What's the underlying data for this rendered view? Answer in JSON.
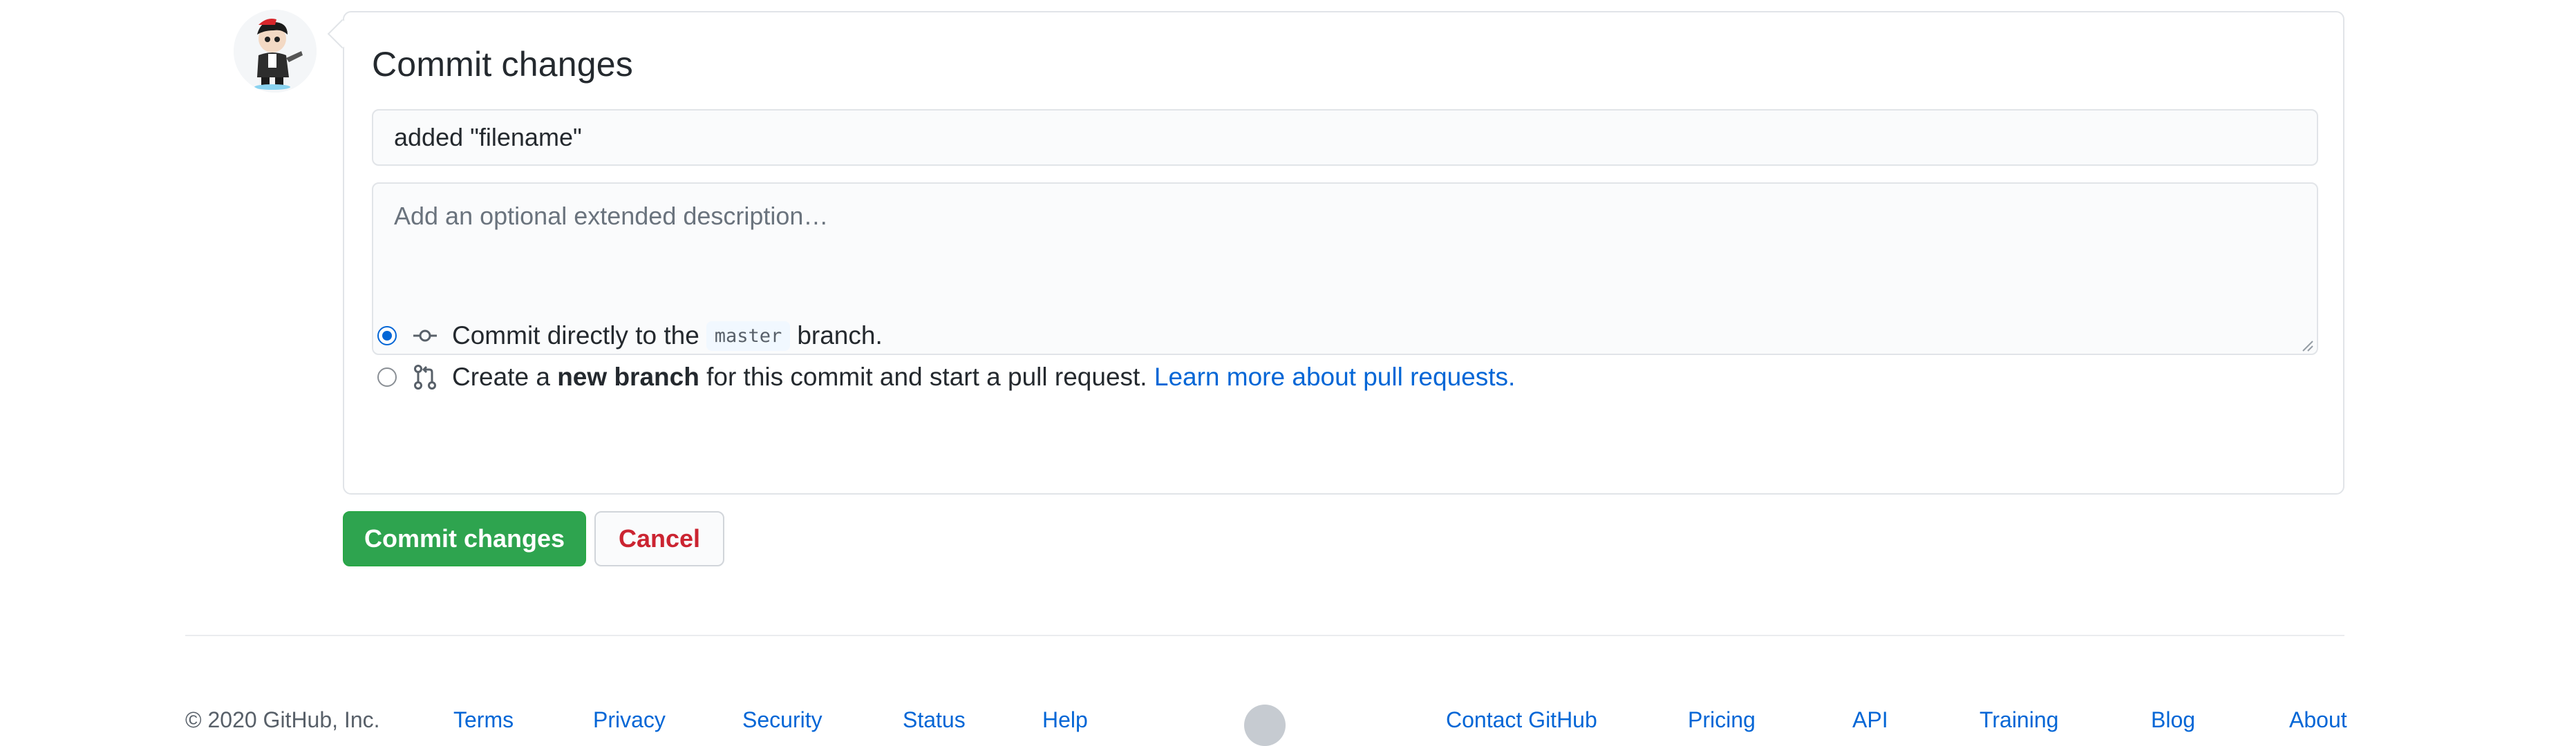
{
  "commit_box": {
    "title": "Commit changes",
    "summary_value": "added \"filename\"",
    "description_placeholder": "Add an optional extended description…"
  },
  "options": {
    "direct": {
      "prefix": "Commit directly to the",
      "branch": "master",
      "suffix": "branch.",
      "checked": true
    },
    "new_branch": {
      "prefix": "Create a",
      "bold": "new branch",
      "middle": "for this commit and start a pull request.",
      "link": "Learn more about pull requests.",
      "checked": false
    }
  },
  "buttons": {
    "commit": "Commit changes",
    "cancel": "Cancel"
  },
  "footer": {
    "copyright": "© 2020 GitHub, Inc.",
    "links_left": [
      "Terms",
      "Privacy",
      "Security",
      "Status",
      "Help"
    ],
    "links_right": [
      "Contact GitHub",
      "Pricing",
      "API",
      "Training",
      "Blog",
      "About"
    ]
  },
  "colors": {
    "primary_button": "#2ea44f",
    "cancel_text": "#cb2431",
    "link": "#0366d6",
    "radio_checked": "#0366d6"
  },
  "icons": {
    "direct_commit": "git-commit-icon",
    "new_branch": "git-pull-request-icon"
  }
}
